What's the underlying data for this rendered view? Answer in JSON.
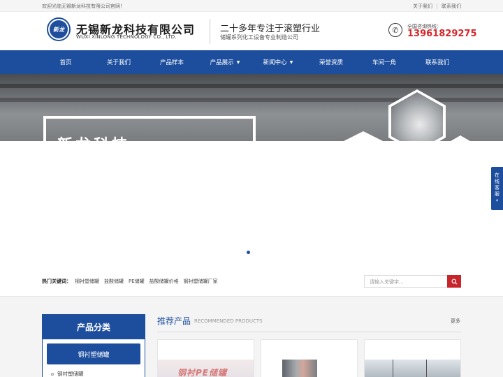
{
  "topbar": {
    "welcome": "欢迎光临无锡新龙科技有限公司官网！",
    "links": [
      "关于我们",
      "联系我们"
    ]
  },
  "header": {
    "logo_mark": "新龙",
    "company_cn": "无锡新龙科技有限公司",
    "company_en": "WUXI XINLONG TECHNOLOGY CO., LTD.",
    "slogan_main": "二十多年专注于滚塑行业",
    "slogan_sub": "储罐系列化工设备专业制造公司",
    "hotline_label": "全国咨询热线：",
    "hotline_number": "13961829275"
  },
  "nav": {
    "items": [
      {
        "label": "首页"
      },
      {
        "label": "关于我们"
      },
      {
        "label": "产品样本"
      },
      {
        "label": "产品展示",
        "dropdown": true
      },
      {
        "label": "新闻中心",
        "dropdown": true
      },
      {
        "label": "荣誉资质"
      },
      {
        "label": "车间一角"
      },
      {
        "label": "联系我们"
      }
    ]
  },
  "banner": {
    "headline": "新龙科技"
  },
  "keywords": {
    "label": "热门关键词：",
    "items": [
      "钢衬塑储罐",
      "盐酸储罐",
      "PE储罐",
      "盐酸储罐价格",
      "钢衬塑储罐厂家"
    ]
  },
  "search": {
    "placeholder": "请输入关键字..."
  },
  "category": {
    "title": "产品分类",
    "active": "钢衬塑储罐",
    "sub_items": [
      "钢衬塑储罐"
    ]
  },
  "recommended": {
    "title": "推荐产品",
    "title_en": "RECOMMENDED PRODUCTS",
    "more": "更多",
    "card1_text": "钢衬PE储罐"
  },
  "float_service": {
    "chars": [
      "在",
      "线",
      "客",
      "服"
    ],
    "arrow": "«"
  },
  "colors": {
    "primary": "#1d4e9d",
    "accent_red": "#d6262a",
    "search_button": "#c8242b"
  },
  "icons": [
    "phone-icon",
    "search-icon",
    "dropdown-caret-icon",
    "double-chevron-icon"
  ]
}
